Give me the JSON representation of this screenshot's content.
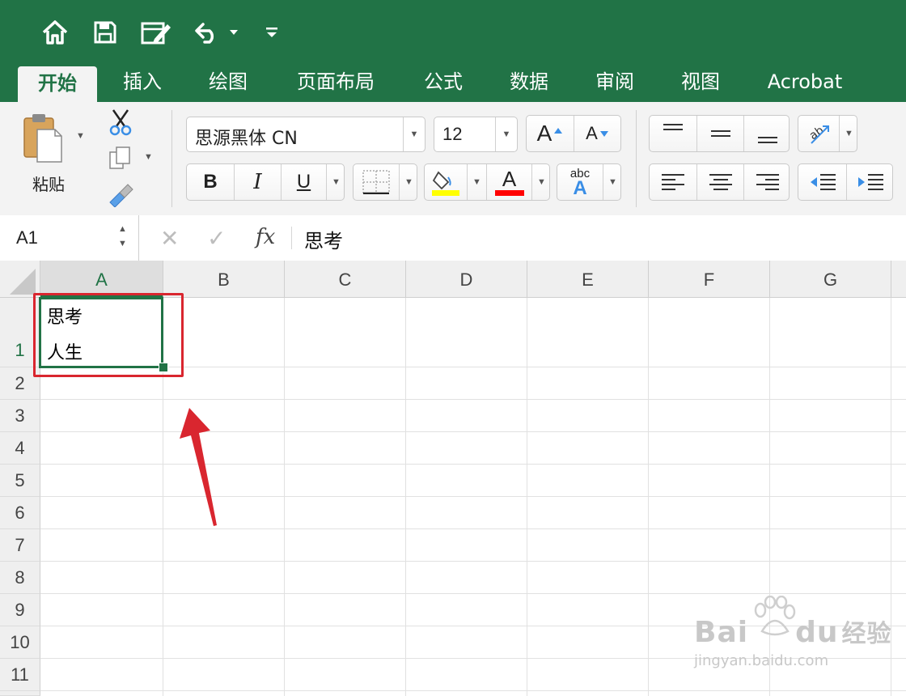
{
  "colors": {
    "excel_green": "#217346",
    "annotation_red": "#d9262f",
    "highlight_yellow": "#ffff00",
    "font_red": "#ff0000",
    "accent_blue": "#3a8ee6"
  },
  "quick_access": {
    "icons": [
      "home-icon",
      "save-icon",
      "edit-icon",
      "undo-icon",
      "customize-icon"
    ]
  },
  "tabs": [
    {
      "label": "开始",
      "active": true
    },
    {
      "label": "插入"
    },
    {
      "label": "绘图"
    },
    {
      "label": "页面布局"
    },
    {
      "label": "公式"
    },
    {
      "label": "数据"
    },
    {
      "label": "审阅"
    },
    {
      "label": "视图"
    },
    {
      "label": "Acrobat"
    }
  ],
  "ribbon": {
    "paste_label": "粘贴",
    "font_name": "思源黑体 CN",
    "font_size": "12",
    "grow_font": "A",
    "shrink_font": "A",
    "bold": "B",
    "italic": "I",
    "underline": "U",
    "font_color_glyph": "A",
    "phonetic_small": "abc",
    "phonetic_big": "A"
  },
  "formula_bar": {
    "name_box": "A1",
    "fx": "fx",
    "content": "思考"
  },
  "grid": {
    "columns": [
      "A",
      "B",
      "C",
      "D",
      "E",
      "F",
      "G"
    ],
    "rows": [
      "1",
      "2",
      "3",
      "4",
      "5",
      "6",
      "7",
      "8",
      "9",
      "10",
      "11"
    ],
    "selected_cell": "A1",
    "cell_a1_lines": [
      "思考",
      "人生"
    ]
  },
  "watermark": {
    "brand": "Bai",
    "brand2": "du",
    "suffix": "经验",
    "url": "jingyan.baidu.com"
  }
}
